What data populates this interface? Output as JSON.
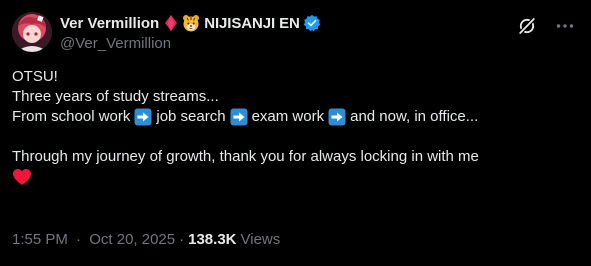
{
  "author": {
    "display_name": "Ver Vermillion",
    "org_name": "NIJISANJI EN",
    "handle": "@Ver_Vermillion"
  },
  "icons": {
    "avatar": "avatar",
    "diamond": "red-diamond-icon",
    "tiger": "tiger-face-icon",
    "verified": "verified-badge-icon",
    "grok": "grok-icon",
    "more": "more-icon",
    "arrow": "right-arrow-emoji-icon",
    "heart": "red-heart-icon"
  },
  "colors": {
    "background": "#000000",
    "text": "#e7e9ea",
    "secondary": "#71767b",
    "verified": "#1d9bf0",
    "diamond": "#e0245e",
    "heart": "#f0163a",
    "arrow_bg": "#2b8fd8"
  },
  "post": {
    "line1": "OTSU!",
    "line2": "Three years of study streams...",
    "line3_parts": [
      "From school work",
      "job search",
      "exam work",
      "and now, in office..."
    ],
    "line4": "Through my journey of growth, thank you for always locking in with me"
  },
  "meta": {
    "time": "1:55 PM",
    "separator": "·",
    "date": "Oct 20, 2025",
    "views_count": "138.3K",
    "views_label": "Views"
  }
}
